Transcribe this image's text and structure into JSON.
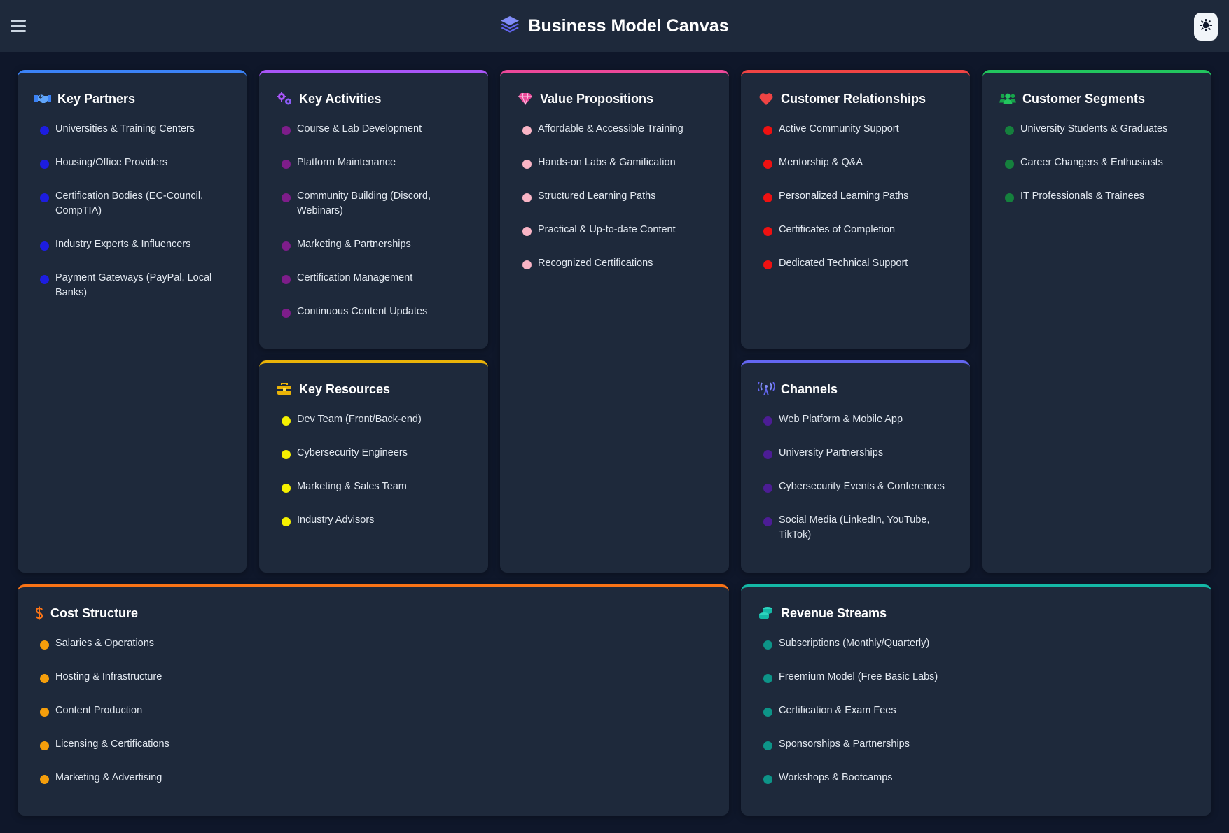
{
  "header": {
    "title": "Business Model Canvas",
    "menu_icon": "hamburger-menu-icon",
    "logo_icon": "layers-icon",
    "theme_icon": "sun-icon"
  },
  "cards": {
    "key_partners": {
      "title": "Key Partners",
      "icon": "handshake-icon",
      "accent": "#3b82f6",
      "dot": "#1d1de0",
      "items": [
        "Universities & Training Centers",
        "Housing/Office Providers",
        "Certification Bodies (EC-Council, CompTIA)",
        "Industry Experts & Influencers",
        "Payment Gateways (PayPal, Local Banks)"
      ]
    },
    "key_activities": {
      "title": "Key Activities",
      "icon": "cogs-icon",
      "accent": "#a855f7",
      "dot": "#7e1d8a",
      "items": [
        "Course & Lab Development",
        "Platform Maintenance",
        "Community Building (Discord, Webinars)",
        "Marketing & Partnerships",
        "Certification Management",
        "Continuous Content Updates"
      ]
    },
    "key_resources": {
      "title": "Key Resources",
      "icon": "toolbox-icon",
      "accent": "#eab308",
      "dot": "#f5f000",
      "items": [
        "Dev Team (Front/Back-end)",
        "Cybersecurity Engineers",
        "Marketing & Sales Team",
        "Industry Advisors"
      ]
    },
    "value_propositions": {
      "title": "Value Propositions",
      "icon": "gem-icon",
      "accent": "#ec4899",
      "dot": "#f9b4c5",
      "items": [
        "Affordable & Accessible Training",
        "Hands-on Labs & Gamification",
        "Structured Learning Paths",
        "Practical & Up-to-date Content",
        "Recognized Certifications"
      ]
    },
    "customer_relationships": {
      "title": "Customer Relationships",
      "icon": "heart-icon",
      "accent": "#ef4444",
      "dot": "#ef1111",
      "items": [
        "Active Community Support",
        "Mentorship & Q&A",
        "Personalized Learning Paths",
        "Certificates of Completion",
        "Dedicated Technical Support"
      ]
    },
    "channels": {
      "title": "Channels",
      "icon": "broadcast-tower-icon",
      "accent": "#6366f1",
      "dot": "#4c1d95",
      "items": [
        "Web Platform & Mobile App",
        "University Partnerships",
        "Cybersecurity Events & Conferences",
        "Social Media (LinkedIn, YouTube, TikTok)"
      ]
    },
    "customer_segments": {
      "title": "Customer Segments",
      "icon": "users-icon",
      "accent": "#22c55e",
      "dot": "#15803d",
      "items": [
        "University Students & Graduates",
        "Career Changers & Enthusiasts",
        "IT Professionals & Trainees"
      ]
    },
    "cost_structure": {
      "title": "Cost Structure",
      "icon": "dollar-icon",
      "accent": "#f97316",
      "dot": "#f59e0b",
      "items": [
        "Salaries & Operations",
        "Hosting & Infrastructure",
        "Content Production",
        "Licensing & Certifications",
        "Marketing & Advertising"
      ]
    },
    "revenue_streams": {
      "title": "Revenue Streams",
      "icon": "coins-icon",
      "accent": "#14b8a6",
      "dot": "#0d9488",
      "items": [
        "Subscriptions (Monthly/Quarterly)",
        "Freemium Model (Free Basic Labs)",
        "Certification & Exam Fees",
        "Sponsorships & Partnerships",
        "Workshops & Bootcamps"
      ]
    }
  }
}
